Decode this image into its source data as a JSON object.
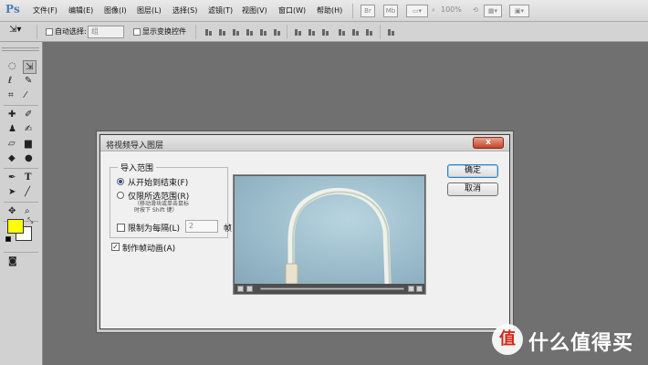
{
  "app": {
    "logo": "Ps",
    "menu": [
      "文件(F)",
      "编辑(E)",
      "图像(I)",
      "图层(L)",
      "选择(S)",
      "滤镜(T)",
      "视图(V)",
      "窗口(W)",
      "帮助(H)"
    ],
    "icons": [
      "bridge-icon",
      "mini-bridge-icon",
      "screen-mode-icon",
      "hand-tool-icon",
      "zoom-tool-icon",
      "rotate-view-icon",
      "arrange-documents-icon"
    ],
    "zoom": "100%"
  },
  "options": {
    "auto_select_label": "自动选择:",
    "auto_select_value": "组",
    "show_transform_label": "显示变换控件"
  },
  "toolbox": {
    "tools": [
      "marquee",
      "move",
      "lasso",
      "quick-selection",
      "crop",
      "eyedropper",
      "spot-healing",
      "brush",
      "clone-stamp",
      "history-brush",
      "eraser",
      "gradient",
      "blur",
      "dodge",
      "pen",
      "type",
      "path-selection",
      "line",
      "3d-rotate",
      "zoom"
    ],
    "fg_color": "#ffff00",
    "bg_color": "#ffffff"
  },
  "dialog": {
    "title": "将视频导入图层",
    "close": "x",
    "range_group": "导入范围",
    "opt_all": "从开始到结束(F)",
    "opt_selected": "仅限所选范围(R)",
    "note_line1": "（移动滑块或单击鼠标",
    "note_line2": "时按下 Shift 键）",
    "limit_label": "限制为每隔(L)",
    "limit_value": "2",
    "frames_unit": "帧",
    "make_animation": "制作帧动画(A)",
    "ok": "确定",
    "cancel": "取消"
  },
  "watermark": {
    "logo": "值",
    "text": "什么值得买"
  }
}
